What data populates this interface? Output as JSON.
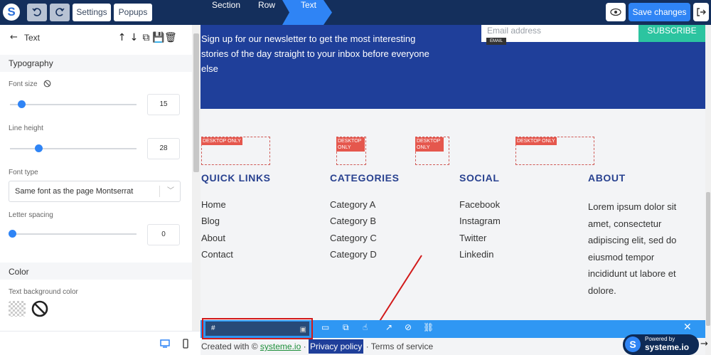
{
  "topbar": {
    "logo_letter": "S",
    "undo_icon": "undo-icon",
    "redo_icon": "redo-icon",
    "settings_label": "Settings",
    "popups_label": "Popups",
    "nav_section": "Section",
    "nav_row": "Row",
    "nav_text": "Text",
    "save_label": "Save changes"
  },
  "panel": {
    "title": "Text",
    "section_typography": "Typography",
    "font_size_label": "Font size",
    "font_size_value": "15",
    "line_height_label": "Line height",
    "line_height_value": "28",
    "font_type_label": "Font type",
    "font_type_value": "Same font as the page Montserrat",
    "letter_spacing_label": "Letter spacing",
    "letter_spacing_value": "0",
    "section_color": "Color",
    "text_bg_label": "Text background color"
  },
  "canvas": {
    "hero_text": "Sign up for our newsletter to get the most interesting stories of the day straight to your inbox before everyone else",
    "email_placeholder": "Email address",
    "subscribe_label": "SUBSCRIBE",
    "email_tag": "EMAIL",
    "desktop_only": "DESKTOP ONLY",
    "columns": {
      "quick_links": {
        "title": "QUICK LINKS",
        "items": [
          "Home",
          "Blog",
          "About",
          "Contact"
        ]
      },
      "categories": {
        "title": "CATEGORIES",
        "items": [
          "Category A",
          "Category B",
          "Category C",
          "Category D"
        ]
      },
      "social": {
        "title": "SOCIAL",
        "items": [
          "Facebook",
          "Instagram",
          "Twitter",
          "Linkedin"
        ]
      },
      "about": {
        "title": "ABOUT",
        "text": "Lorem ipsum dolor sit amet, consectetur adipiscing elit, sed do eiusmod tempor incididunt ut labore et dolore."
      }
    },
    "link_value": "#",
    "footer": {
      "created_with": "Created with ©",
      "brand_link": "systeme.io",
      "dot1": "·",
      "privacy": "Privacy policy",
      "dot2": "·",
      "terms": "Terms of service"
    },
    "powered_by": "Powered by",
    "powered_brand": "systeme.io"
  },
  "colors": {
    "topbar": "#142f5c",
    "accent": "#2f84f5",
    "hero": "#1f3f9a",
    "heading": "#294290",
    "subscribe": "#2cc4a0",
    "highlight": "#d21a1a"
  }
}
